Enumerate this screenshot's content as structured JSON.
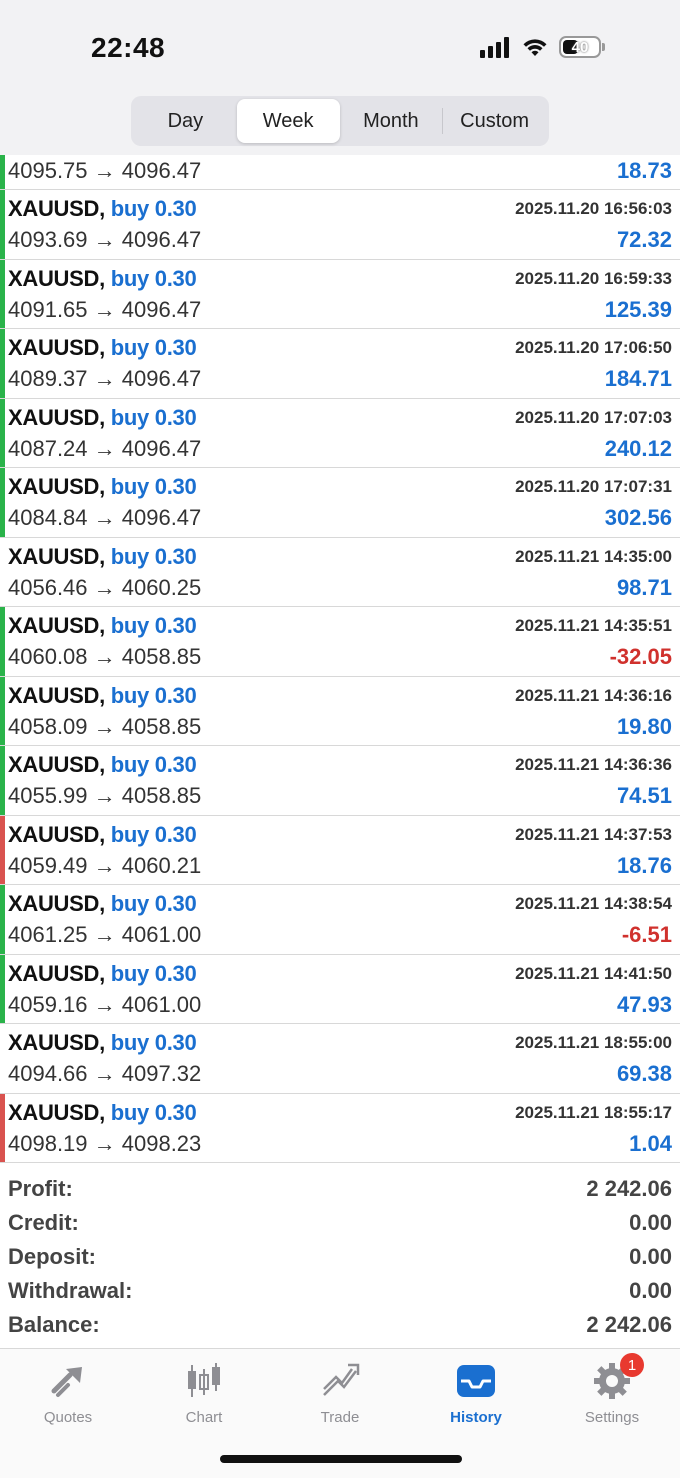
{
  "status_bar": {
    "time": "22:48",
    "battery": "40"
  },
  "segments": [
    {
      "label": "Day",
      "active": false
    },
    {
      "label": "Week",
      "active": true
    },
    {
      "label": "Month",
      "active": false
    },
    {
      "label": "Custom",
      "active": false
    }
  ],
  "colors": {
    "accent": "#1a6fd0",
    "negative": "#d0312d",
    "bar_green": "#2ab34a",
    "bar_red": "#d9534f"
  },
  "deals": [
    {
      "symbol": "",
      "type": "",
      "date": "",
      "prices": "4095.75 → 4096.47",
      "profit": "18.73",
      "negative": false,
      "bar": "green",
      "partial": true
    },
    {
      "symbol": "XAUUSD,",
      "type": "buy 0.30",
      "date": "2025.11.20 16:56:03",
      "prices": "4093.69 → 4096.47",
      "profit": "72.32",
      "negative": false,
      "bar": "green"
    },
    {
      "symbol": "XAUUSD,",
      "type": "buy 0.30",
      "date": "2025.11.20 16:59:33",
      "prices": "4091.65 → 4096.47",
      "profit": "125.39",
      "negative": false,
      "bar": "green"
    },
    {
      "symbol": "XAUUSD,",
      "type": "buy 0.30",
      "date": "2025.11.20 17:06:50",
      "prices": "4089.37 → 4096.47",
      "profit": "184.71",
      "negative": false,
      "bar": "green"
    },
    {
      "symbol": "XAUUSD,",
      "type": "buy 0.30",
      "date": "2025.11.20 17:07:03",
      "prices": "4087.24 → 4096.47",
      "profit": "240.12",
      "negative": false,
      "bar": "green"
    },
    {
      "symbol": "XAUUSD,",
      "type": "buy 0.30",
      "date": "2025.11.20 17:07:31",
      "prices": "4084.84 → 4096.47",
      "profit": "302.56",
      "negative": false,
      "bar": "green"
    },
    {
      "symbol": "XAUUSD,",
      "type": "buy 0.30",
      "date": "2025.11.21 14:35:00",
      "prices": "4056.46 → 4060.25",
      "profit": "98.71",
      "negative": false,
      "bar": "none"
    },
    {
      "symbol": "XAUUSD,",
      "type": "buy 0.30",
      "date": "2025.11.21 14:35:51",
      "prices": "4060.08 → 4058.85",
      "profit": "-32.05",
      "negative": true,
      "bar": "green"
    },
    {
      "symbol": "XAUUSD,",
      "type": "buy 0.30",
      "date": "2025.11.21 14:36:16",
      "prices": "4058.09 → 4058.85",
      "profit": "19.80",
      "negative": false,
      "bar": "green"
    },
    {
      "symbol": "XAUUSD,",
      "type": "buy 0.30",
      "date": "2025.11.21 14:36:36",
      "prices": "4055.99 → 4058.85",
      "profit": "74.51",
      "negative": false,
      "bar": "green"
    },
    {
      "symbol": "XAUUSD,",
      "type": "buy 0.30",
      "date": "2025.11.21 14:37:53",
      "prices": "4059.49 → 4060.21",
      "profit": "18.76",
      "negative": false,
      "bar": "red"
    },
    {
      "symbol": "XAUUSD,",
      "type": "buy 0.30",
      "date": "2025.11.21 14:38:54",
      "prices": "4061.25 → 4061.00",
      "profit": "-6.51",
      "negative": true,
      "bar": "green"
    },
    {
      "symbol": "XAUUSD,",
      "type": "buy 0.30",
      "date": "2025.11.21 14:41:50",
      "prices": "4059.16 → 4061.00",
      "profit": "47.93",
      "negative": false,
      "bar": "green"
    },
    {
      "symbol": "XAUUSD,",
      "type": "buy 0.30",
      "date": "2025.11.21 18:55:00",
      "prices": "4094.66 → 4097.32",
      "profit": "69.38",
      "negative": false,
      "bar": "none"
    },
    {
      "symbol": "XAUUSD,",
      "type": "buy 0.30",
      "date": "2025.11.21 18:55:17",
      "prices": "4098.19 → 4098.23",
      "profit": "1.04",
      "negative": false,
      "bar": "red"
    }
  ],
  "summary": [
    {
      "label": "Profit:",
      "value": "2 242.06"
    },
    {
      "label": "Credit:",
      "value": "0.00"
    },
    {
      "label": "Deposit:",
      "value": "0.00"
    },
    {
      "label": "Withdrawal:",
      "value": "0.00"
    },
    {
      "label": "Balance:",
      "value": "2 242.06"
    }
  ],
  "tabs": [
    {
      "label": "Quotes",
      "icon": "quotes-icon",
      "active": false
    },
    {
      "label": "Chart",
      "icon": "candlestick-chart-icon",
      "active": false
    },
    {
      "label": "Trade",
      "icon": "trade-icon",
      "active": false
    },
    {
      "label": "History",
      "icon": "history-inbox-icon",
      "active": true
    },
    {
      "label": "Settings",
      "icon": "gear-icon",
      "active": false,
      "badge": "1"
    }
  ]
}
